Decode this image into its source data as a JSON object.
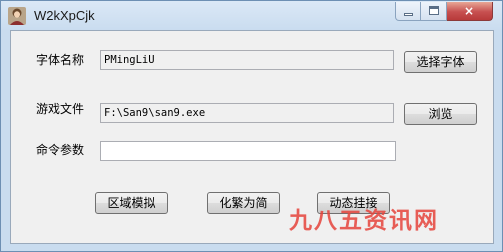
{
  "window": {
    "title": "W2kXpCjk",
    "controls": {
      "minimize": "minimize",
      "maximize": "maximize",
      "close": "×"
    }
  },
  "form": {
    "font_name_label": "字体名称",
    "font_name_value": "PMingLiU",
    "select_font_button": "选择字体",
    "game_file_label": "游戏文件",
    "game_file_value": "F:\\San9\\san9.exe",
    "browse_button": "浏览",
    "command_args_label": "命令参数",
    "command_args_value": ""
  },
  "actions": {
    "region_simulate": "区域模拟",
    "traditional_to_simplified": "化繁为简",
    "dynamic_hook": "动态挂接"
  },
  "watermark": "九八五资讯网",
  "colors": {
    "watermark": "#e6443c",
    "frame": "#c9dcef",
    "close_button": "#c75050"
  }
}
